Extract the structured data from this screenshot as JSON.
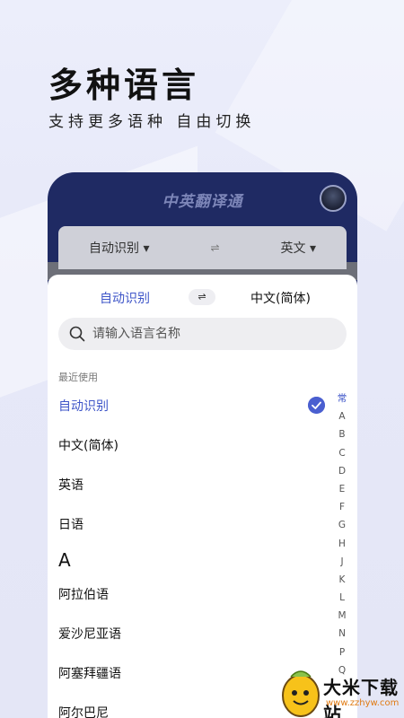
{
  "promo": {
    "headline": "多种语言",
    "subline": "支持更多语种  自由切换"
  },
  "app": {
    "title": "中英翻译通",
    "source_lang": "自动识别",
    "target_lang": "英文",
    "swap_symbol": "⇌"
  },
  "picker": {
    "source_lang": "自动识别",
    "target_lang": "中文(简体)",
    "swap_symbol": "⇌",
    "search_placeholder": "请输入语言名称",
    "recent_label": "最近使用",
    "recent": [
      "自动识别",
      "中文(简体)",
      "英语",
      "日语"
    ],
    "selected": "自动识别",
    "group_a_header": "A",
    "group_a": [
      "阿拉伯语",
      "爱沙尼亚语",
      "阿塞拜疆语",
      "阿尔巴尼"
    ],
    "index": [
      "常",
      "A",
      "B",
      "C",
      "D",
      "E",
      "F",
      "G",
      "H",
      "J",
      "K",
      "L",
      "M",
      "N",
      "P",
      "Q"
    ]
  },
  "watermark": {
    "brand": "大米下载站",
    "url": "www.zzhyw.com"
  },
  "colors": {
    "accent": "#3e55c8",
    "phone_bg": "#1f2a63",
    "check_bg": "#4a5fd0"
  }
}
